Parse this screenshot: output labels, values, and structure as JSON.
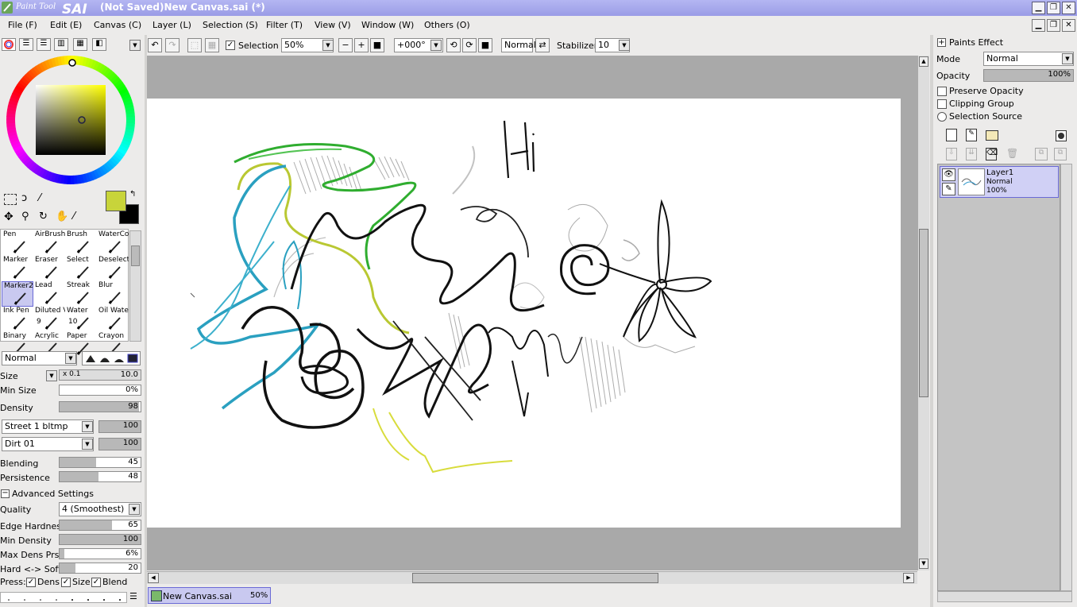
{
  "app": {
    "title": "(Not Saved)New Canvas.sai (*)",
    "logo_small": "Paint Tool",
    "logo_big": "SAI"
  },
  "menu": [
    "File (F)",
    "Edit (E)",
    "Canvas (C)",
    "Layer (L)",
    "Selection (S)",
    "Filter (T)",
    "View (V)",
    "Window (W)",
    "Others (O)"
  ],
  "toolbar": {
    "selection_label": "Selection",
    "selection_checked": true,
    "zoom": "50%",
    "rotation": "+000°",
    "blend_mode": "Normal",
    "stabilizer_label": "Stabilizer",
    "stabilizer_value": "10"
  },
  "colors": {
    "primary": "#c8d43a",
    "secondary": "#000000"
  },
  "tools": [
    {
      "name": "Pen"
    },
    {
      "name": "AirBrush"
    },
    {
      "name": "Brush"
    },
    {
      "name": "WaterCo"
    },
    {
      "name": "Marker"
    },
    {
      "name": "Eraser"
    },
    {
      "name": "Select"
    },
    {
      "name": "Deselect"
    },
    {
      "name": "Marker2",
      "selected": true
    },
    {
      "name": "Lead"
    },
    {
      "name": "Streak"
    },
    {
      "name": "Blur"
    },
    {
      "name": "Ink Pen"
    },
    {
      "name": "Diluted V",
      "sub": "9"
    },
    {
      "name": "Water",
      "sub": "10"
    },
    {
      "name": "Oil Water"
    },
    {
      "name": "Binary"
    },
    {
      "name": "Acrylic"
    },
    {
      "name": "Paper"
    },
    {
      "name": "Crayon"
    }
  ],
  "brush": {
    "mode": "Normal",
    "size_label": "Size",
    "size_multiplier": "x 0.1",
    "size_value": "10.0",
    "min_size_label": "Min Size",
    "min_size_value": "0%",
    "density_label": "Density",
    "density_value": "98",
    "texture1": "Street 1 bltmp",
    "texture1_value": "100",
    "texture2": "Dirt 01",
    "texture2_value": "100",
    "blending_label": "Blending",
    "blending_value": "45",
    "persistence_label": "Persistence",
    "persistence_value": "48",
    "advanced_label": "Advanced Settings",
    "quality_label": "Quality",
    "quality_value": "4 (Smoothest)",
    "edge_hardness_label": "Edge Hardness",
    "edge_hardness_value": "65",
    "min_density_label": "Min Density",
    "min_density_value": "100",
    "max_dens_label": "Max Dens Prs.",
    "max_dens_value": "6%",
    "hard_soft_label": "Hard <-> Soft",
    "hard_soft_value": "20",
    "press_label": "Press:",
    "press_dens": "Dens",
    "press_size": "Size",
    "press_blend": "Blend"
  },
  "sliders": {
    "density": 0.98,
    "blending": 0.45,
    "persistence": 0.48,
    "edge_hardness": 0.65,
    "min_density": 1.0,
    "max_dens": 0.06,
    "hard_soft": 0.2
  },
  "right": {
    "paints_effect": "Paints Effect",
    "mode_label": "Mode",
    "mode_value": "Normal",
    "opacity_label": "Opacity",
    "opacity_value": "100%",
    "preserve_opacity": "Preserve Opacity",
    "clipping_group": "Clipping Group",
    "selection_source": "Selection Source"
  },
  "layers": [
    {
      "name": "Layer1",
      "mode": "Normal",
      "opacity": "100%"
    }
  ],
  "canvas_tab": {
    "name": "New Canvas.sai",
    "zoom": "50%"
  },
  "canvas_text": "Hi"
}
